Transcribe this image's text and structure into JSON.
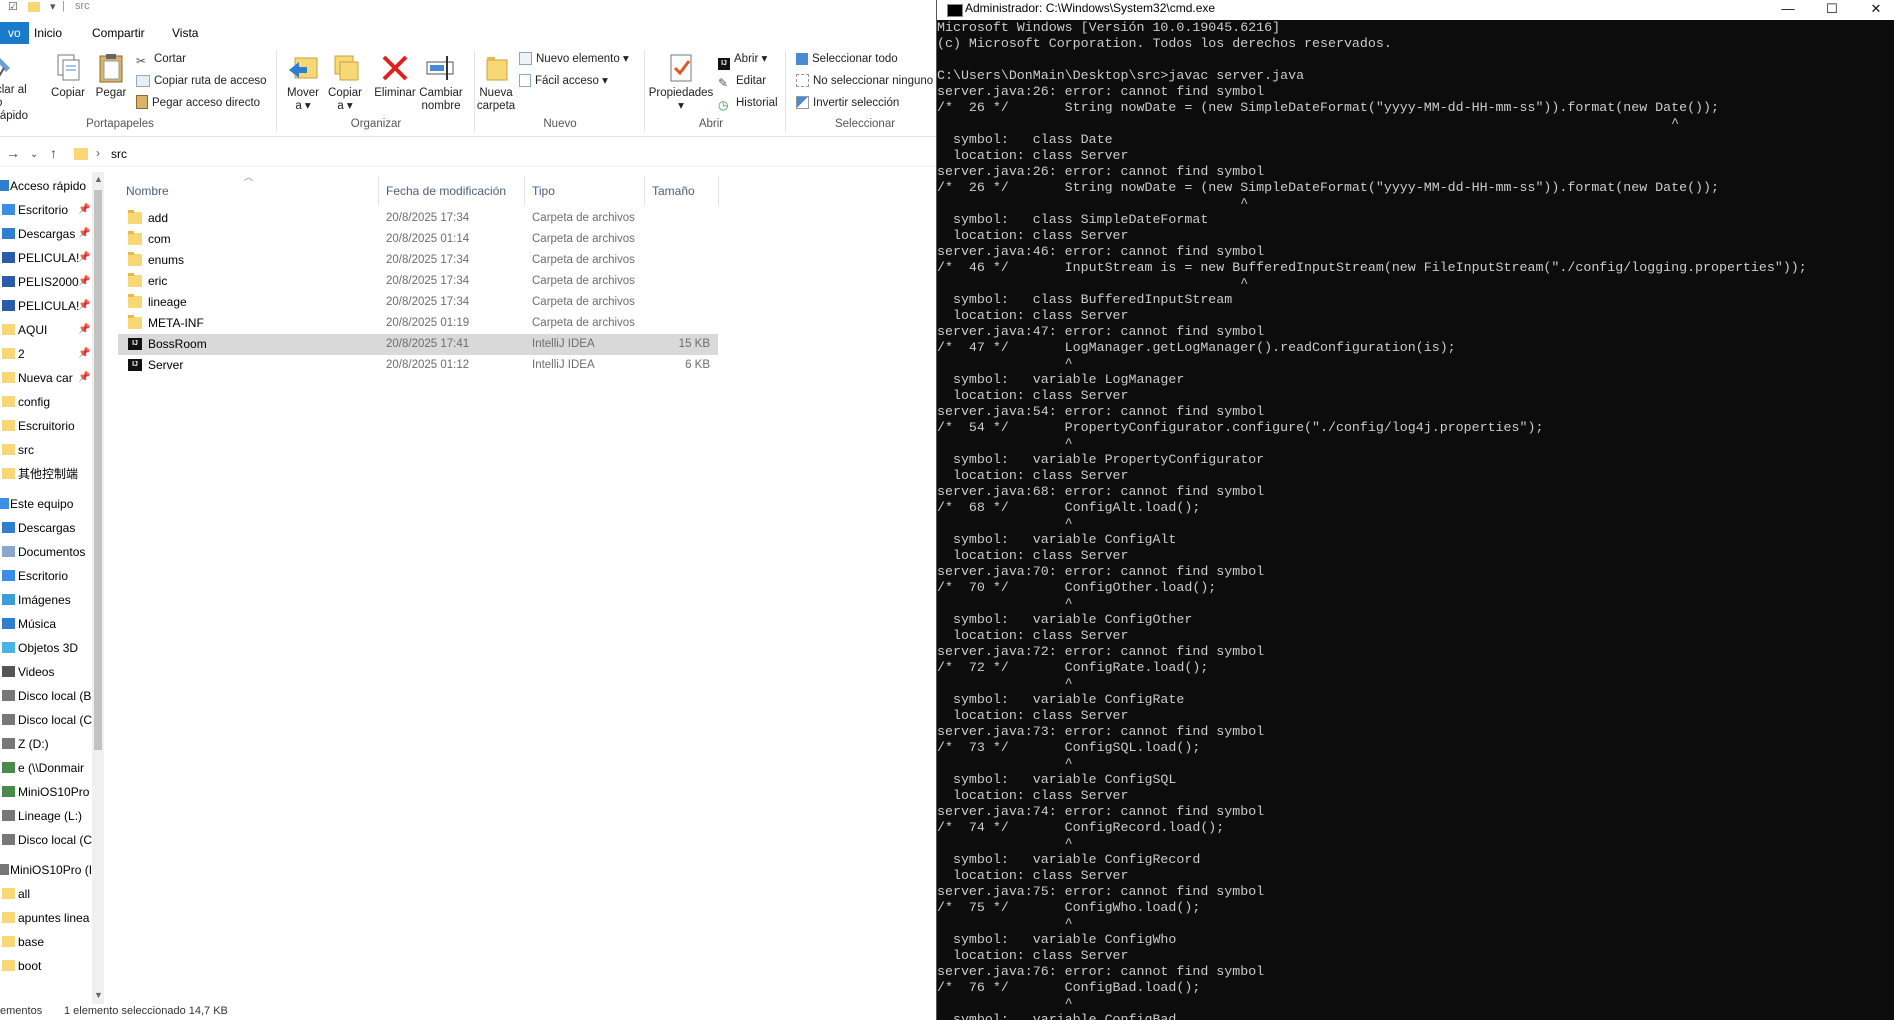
{
  "explorer": {
    "title": "src",
    "menu_tabs": [
      "vo",
      "Inicio",
      "Compartir",
      "Vista"
    ],
    "ribbon": {
      "portapapeles": {
        "group_label": "Portapapeles",
        "anclar_label_1": "clar al",
        "anclar_label_2": "o rápido",
        "copiar_label": "Copiar",
        "pegar_label": "Pegar",
        "cortar_label": "Cortar",
        "copiar_ruta_label": "Copiar ruta de acceso",
        "pegar_acceso_label": "Pegar acceso directo"
      },
      "organizar": {
        "group_label": "Organizar",
        "mover_label_1": "Mover",
        "mover_label_2": "a",
        "copiar_a_label_1": "Copiar",
        "copiar_a_label_2": "a",
        "eliminar_label": "Eliminar",
        "cambiar_label_1": "Cambiar",
        "cambiar_label_2": "nombre"
      },
      "nuevo": {
        "group_label": "Nuevo",
        "nueva_carpeta_label_1": "Nueva",
        "nueva_carpeta_label_2": "carpeta",
        "nuevo_elemento_label": "Nuevo elemento",
        "facil_acceso_label": "Fácil acceso"
      },
      "abrir": {
        "group_label": "Abrir",
        "propiedades_label": "Propiedades",
        "abrir_label": "Abrir",
        "editar_label": "Editar",
        "historial_label": "Historial"
      },
      "seleccionar": {
        "group_label": "Seleccionar",
        "todo_label": "Seleccionar todo",
        "ninguno_label": "No seleccionar ninguno",
        "invertir_label": "Invertir selección"
      }
    },
    "address": {
      "path": "src"
    },
    "nav": [
      {
        "label": "Acceso rápido",
        "icon": "star-icon",
        "pinned": false,
        "indent": 0
      },
      {
        "label": "Escritorio",
        "icon": "desktop-icon",
        "pinned": true,
        "indent": 1
      },
      {
        "label": "Descargas",
        "icon": "download-icon",
        "pinned": true,
        "indent": 1
      },
      {
        "label": "PELICULA!",
        "icon": "monitor-icon",
        "pinned": true,
        "indent": 1
      },
      {
        "label": "PELIS2000",
        "icon": "monitor-icon",
        "pinned": true,
        "indent": 1
      },
      {
        "label": "PELICULA!",
        "icon": "monitor-icon",
        "pinned": true,
        "indent": 1
      },
      {
        "label": "AQUI",
        "icon": "folder-icon",
        "pinned": true,
        "indent": 1
      },
      {
        "label": "2",
        "icon": "folder-icon",
        "pinned": true,
        "indent": 1
      },
      {
        "label": "Nueva car",
        "icon": "folder-icon",
        "pinned": true,
        "indent": 1
      },
      {
        "label": "config",
        "icon": "folder-icon",
        "pinned": false,
        "indent": 1
      },
      {
        "label": "Escruitorio",
        "icon": "folder-icon",
        "pinned": false,
        "indent": 1
      },
      {
        "label": "src",
        "icon": "folder-icon",
        "pinned": false,
        "indent": 1
      },
      {
        "label": "其他控制端",
        "icon": "folder-icon",
        "pinned": false,
        "indent": 1
      },
      {
        "label": "Este equipo",
        "icon": "computer-icon",
        "pinned": false,
        "indent": 0
      },
      {
        "label": "Descargas",
        "icon": "download-icon",
        "pinned": false,
        "indent": 1
      },
      {
        "label": "Documentos",
        "icon": "document-icon",
        "pinned": false,
        "indent": 1
      },
      {
        "label": "Escritorio",
        "icon": "desktop-icon",
        "pinned": false,
        "indent": 1
      },
      {
        "label": "Imágenes",
        "icon": "image-icon",
        "pinned": false,
        "indent": 1
      },
      {
        "label": "Música",
        "icon": "music-icon",
        "pinned": false,
        "indent": 1
      },
      {
        "label": "Objetos 3D",
        "icon": "cube-icon",
        "pinned": false,
        "indent": 1
      },
      {
        "label": "Videos",
        "icon": "video-icon",
        "pinned": false,
        "indent": 1
      },
      {
        "label": "Disco local (B",
        "icon": "drive-icon",
        "pinned": false,
        "indent": 1
      },
      {
        "label": "Disco local (C",
        "icon": "drive-icon",
        "pinned": false,
        "indent": 1
      },
      {
        "label": "Z (D:)",
        "icon": "drive-icon",
        "pinned": false,
        "indent": 1
      },
      {
        "label": "e (\\\\Donmair",
        "icon": "network-drive-icon",
        "pinned": false,
        "indent": 1
      },
      {
        "label": "MiniOS10Pro",
        "icon": "network-drive-icon",
        "pinned": false,
        "indent": 1
      },
      {
        "label": "Lineage (L:)",
        "icon": "drive-icon",
        "pinned": false,
        "indent": 1
      },
      {
        "label": "Disco local (C",
        "icon": "drive-icon",
        "pinned": false,
        "indent": 1
      },
      {
        "label": "MiniOS10Pro (I",
        "icon": "drive-icon",
        "pinned": false,
        "indent": 0
      },
      {
        "label": "all",
        "icon": "folder-icon",
        "pinned": false,
        "indent": 1
      },
      {
        "label": "apuntes linea",
        "icon": "folder-icon",
        "pinned": false,
        "indent": 1
      },
      {
        "label": "base",
        "icon": "folder-icon",
        "pinned": false,
        "indent": 1
      },
      {
        "label": "boot",
        "icon": "folder-icon",
        "pinned": false,
        "indent": 1
      }
    ],
    "columns": {
      "name": "Nombre",
      "date": "Fecha de modificación",
      "type": "Tipo",
      "size": "Tamaño"
    },
    "files": [
      {
        "name": "add",
        "date": "20/8/2025 17:34",
        "type": "Carpeta de archivos",
        "size": "",
        "icon": "folder-icon",
        "selected": false
      },
      {
        "name": "com",
        "date": "20/8/2025 01:14",
        "type": "Carpeta de archivos",
        "size": "",
        "icon": "folder-icon",
        "selected": false
      },
      {
        "name": "enums",
        "date": "20/8/2025 17:34",
        "type": "Carpeta de archivos",
        "size": "",
        "icon": "folder-icon",
        "selected": false
      },
      {
        "name": "eric",
        "date": "20/8/2025 17:34",
        "type": "Carpeta de archivos",
        "size": "",
        "icon": "folder-icon",
        "selected": false
      },
      {
        "name": "lineage",
        "date": "20/8/2025 17:34",
        "type": "Carpeta de archivos",
        "size": "",
        "icon": "folder-icon",
        "selected": false
      },
      {
        "name": "META-INF",
        "date": "20/8/2025 01:19",
        "type": "Carpeta de archivos",
        "size": "",
        "icon": "folder-icon",
        "selected": false
      },
      {
        "name": "BossRoom",
        "date": "20/8/2025 17:41",
        "type": "IntelliJ IDEA",
        "size": "15 KB",
        "icon": "intellij-file-icon",
        "selected": true
      },
      {
        "name": "Server",
        "date": "20/8/2025 01:12",
        "type": "IntelliJ IDEA",
        "size": "6 KB",
        "icon": "intellij-file-icon",
        "selected": false
      }
    ],
    "status": {
      "count": "ementos",
      "selection": "1 elemento seleccionado  14,7 KB"
    }
  },
  "cmd": {
    "title": "Administrador: C:\\Windows\\System32\\cmd.exe",
    "lines": [
      "Microsoft Windows [Versión 10.0.19045.6216]",
      "(c) Microsoft Corporation. Todos los derechos reservados.",
      "",
      "C:\\Users\\DonMain\\Desktop\\src>javac server.java",
      "server.java:26: error: cannot find symbol",
      "/*  26 */       String nowDate = (new SimpleDateFormat(\"yyyy-MM-dd-HH-mm-ss\")).format(new Date());",
      "                                                                                            ^",
      "  symbol:   class Date",
      "  location: class Server",
      "server.java:26: error: cannot find symbol",
      "/*  26 */       String nowDate = (new SimpleDateFormat(\"yyyy-MM-dd-HH-mm-ss\")).format(new Date());",
      "                                      ^",
      "  symbol:   class SimpleDateFormat",
      "  location: class Server",
      "server.java:46: error: cannot find symbol",
      "/*  46 */       InputStream is = new BufferedInputStream(new FileInputStream(\"./config/logging.properties\"));",
      "                                      ^",
      "  symbol:   class BufferedInputStream",
      "  location: class Server",
      "server.java:47: error: cannot find symbol",
      "/*  47 */       LogManager.getLogManager().readConfiguration(is);",
      "                ^",
      "  symbol:   variable LogManager",
      "  location: class Server",
      "server.java:54: error: cannot find symbol",
      "/*  54 */       PropertyConfigurator.configure(\"./config/log4j.properties\");",
      "                ^",
      "  symbol:   variable PropertyConfigurator",
      "  location: class Server",
      "server.java:68: error: cannot find symbol",
      "/*  68 */       ConfigAlt.load();",
      "                ^",
      "  symbol:   variable ConfigAlt",
      "  location: class Server",
      "server.java:70: error: cannot find symbol",
      "/*  70 */       ConfigOther.load();",
      "                ^",
      "  symbol:   variable ConfigOther",
      "  location: class Server",
      "server.java:72: error: cannot find symbol",
      "/*  72 */       ConfigRate.load();",
      "                ^",
      "  symbol:   variable ConfigRate",
      "  location: class Server",
      "server.java:73: error: cannot find symbol",
      "/*  73 */       ConfigSQL.load();",
      "                ^",
      "  symbol:   variable ConfigSQL",
      "  location: class Server",
      "server.java:74: error: cannot find symbol",
      "/*  74 */       ConfigRecord.load();",
      "                ^",
      "  symbol:   variable ConfigRecord",
      "  location: class Server",
      "server.java:75: error: cannot find symbol",
      "/*  75 */       ConfigWho.load();",
      "                ^",
      "  symbol:   variable ConfigWho",
      "  location: class Server",
      "server.java:76: error: cannot find symbol",
      "/*  76 */       ConfigBad.load();",
      "                ^",
      "  symbol:   variable ConfigBad"
    ]
  }
}
